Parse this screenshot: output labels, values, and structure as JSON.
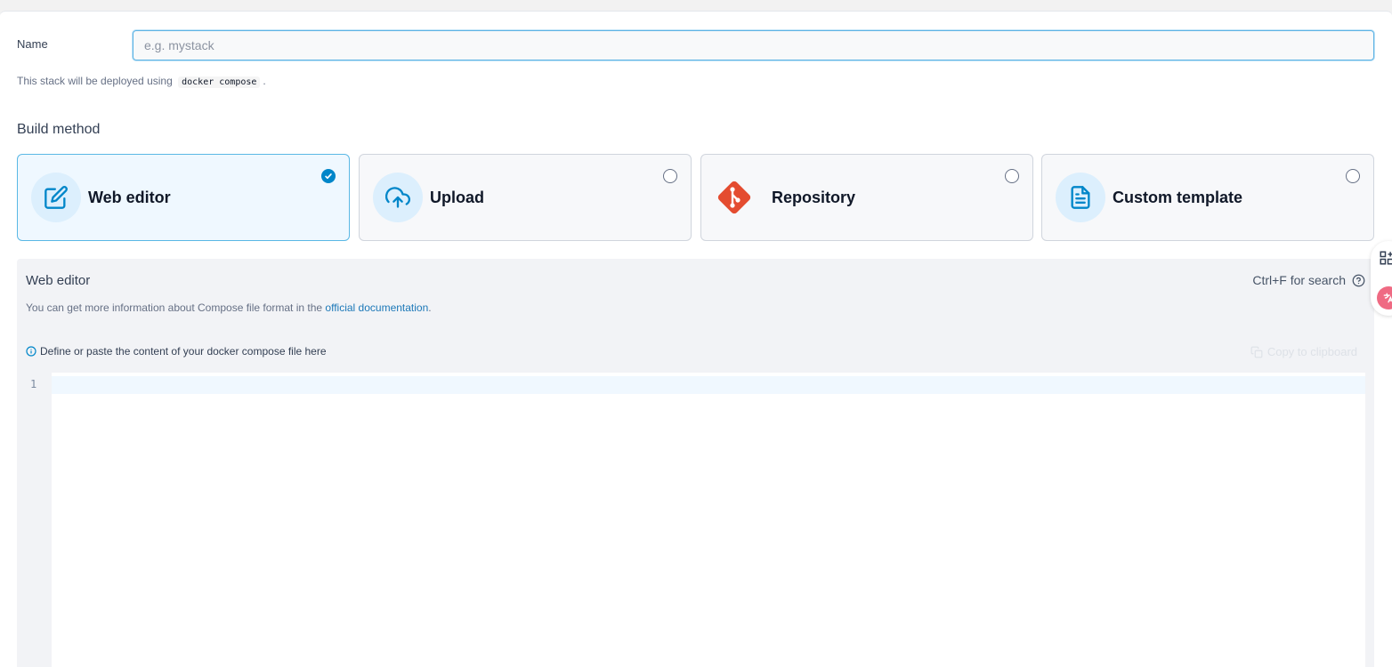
{
  "form": {
    "name_label": "Name",
    "name_placeholder": "e.g. mystack",
    "name_value": "",
    "deploy_note_prefix": "This stack will be deployed using",
    "deploy_note_code": "docker compose",
    "deploy_note_suffix": "."
  },
  "build_method": {
    "title": "Build method",
    "options": [
      {
        "label": "Web editor",
        "icon": "edit-icon",
        "selected": true
      },
      {
        "label": "Upload",
        "icon": "cloud-upload-icon",
        "selected": false
      },
      {
        "label": "Repository",
        "icon": "git-icon",
        "selected": false
      },
      {
        "label": "Custom template",
        "icon": "file-text-icon",
        "selected": false
      }
    ]
  },
  "editor": {
    "title": "Web editor",
    "search_hint": "Ctrl+F for search",
    "info_prefix": "You can get more information about Compose file format in the",
    "info_link": "official documentation",
    "info_suffix": ".",
    "define_note": "Define or paste the content of your docker compose file here",
    "copy_label": "Copy to clipboard",
    "line_numbers": [
      "1"
    ]
  },
  "colors": {
    "accent": "#0086c9",
    "git_brand": "#e44c30",
    "selected_bg": "#eff8ff"
  }
}
